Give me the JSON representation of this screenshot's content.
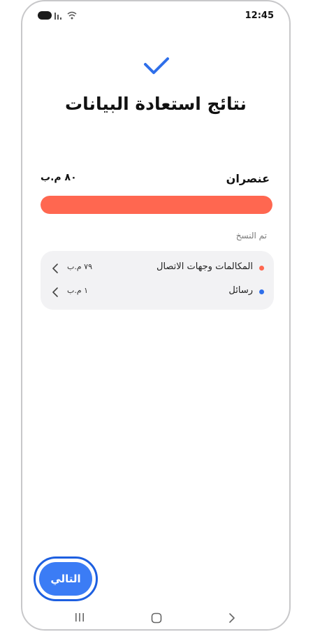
{
  "status_bar": {
    "time": "12:45",
    "icons": [
      "battery-icon",
      "signal-icon",
      "wifi-icon"
    ]
  },
  "header": {
    "icon": "check-icon",
    "title": "نتائج استعادة البيانات"
  },
  "summary": {
    "label": "عنصران",
    "size": "٨٠ م.ب",
    "progress_fraction": 1.0
  },
  "copied_section": {
    "label": "تم النسخ",
    "items": [
      {
        "label": "المكالمات وجهات الاتصال",
        "size": "٧٩ م.ب",
        "dot_color": "#ff6750"
      },
      {
        "label": "رسائل",
        "size": "١ م.ب",
        "dot_color": "#2f6fea"
      }
    ]
  },
  "actions": {
    "next_label": "التالي"
  },
  "colors": {
    "accent": "#3b7cf5",
    "progress": "#ff6750",
    "focus_ring": "#1d5fe0"
  },
  "nav_bar": {
    "icons": [
      "recents-icon",
      "home-icon",
      "back-icon"
    ]
  }
}
